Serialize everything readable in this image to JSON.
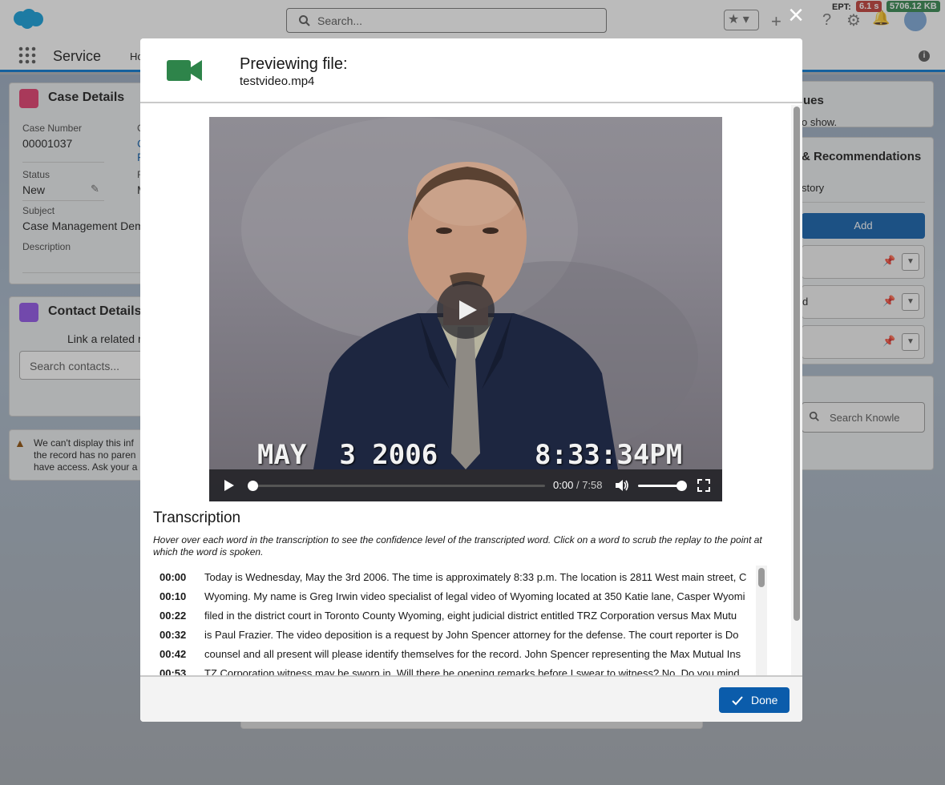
{
  "app": {
    "search_placeholder": "Search...",
    "app_name": "Service",
    "nav_partial": "Ho",
    "ept_label": "EPT:",
    "ept_value": "6.1 s",
    "memory_value": "5706.12 KB"
  },
  "case_details": {
    "title": "Case Details",
    "case_number_label": "Case Number",
    "case_number_value": "00001037",
    "status_label": "Status",
    "status_value": "New",
    "subject_label": "Subject",
    "subject_value": "Case Management Dem",
    "description_label": "Description",
    "col2_partial_1": "C",
    "col2_partial_2": "C",
    "col2_partial_3": "F",
    "col2_partial_4": "F",
    "col2_partial_5": "M"
  },
  "contact_details": {
    "title": "Contact Details",
    "link_text": "Link a related r",
    "search_placeholder": "Search contacts..."
  },
  "warning": {
    "line1": "We can't display this inf",
    "line2": "the record has no paren",
    "line3": "have access. Ask your a"
  },
  "right_panel": {
    "issues_title": "ues",
    "issues_text": "o show.",
    "recs_title": "& Recommendations",
    "history_text": "story",
    "add_label": "Add",
    "row2_text": "d",
    "search_knowledge": "Search Knowle"
  },
  "modal": {
    "title": "Previewing file:",
    "filename": "testvideo.mp4",
    "close_label": "×",
    "done_label": "Done"
  },
  "video": {
    "date_stamp": "MAY  3 2006",
    "time_stamp": "8:33:34PM",
    "current_time": "0:00",
    "separator": "/",
    "duration": "7:58",
    "progress": 0,
    "volume": 1
  },
  "transcription": {
    "heading": "Transcription",
    "instructions": "Hover over each word in the transcription to see the confidence level of the transcripted word. Click on a word to scrub the replay to the point at which the word is spoken.",
    "rows": [
      {
        "time": "00:00",
        "text": "Today is Wednesday, May the 3rd 2006. The time is approximately 8:33 p.m. The location is 2811 West main street, C"
      },
      {
        "time": "00:10",
        "text": "Wyoming. My name is Greg Irwin video specialist of legal video of Wyoming located at 350 Katie lane, Casper Wyomi"
      },
      {
        "time": "00:22",
        "text": "filed in the district court in Toronto County Wyoming, eight judicial district entitled TRZ Corporation versus Max Mutu"
      },
      {
        "time": "00:32",
        "text": "is Paul Frazier. The video deposition is a request by John Spencer attorney for the defense. The court reporter is Do"
      },
      {
        "time": "00:42",
        "text": "counsel and all present will please identify themselves for the record. John Spencer representing the Max Mutual Ins"
      },
      {
        "time": "00:53",
        "text": "TZ Corporation witness may be sworn in. Will there be opening remarks before I swear to witness? No. Do you mind"
      }
    ]
  }
}
